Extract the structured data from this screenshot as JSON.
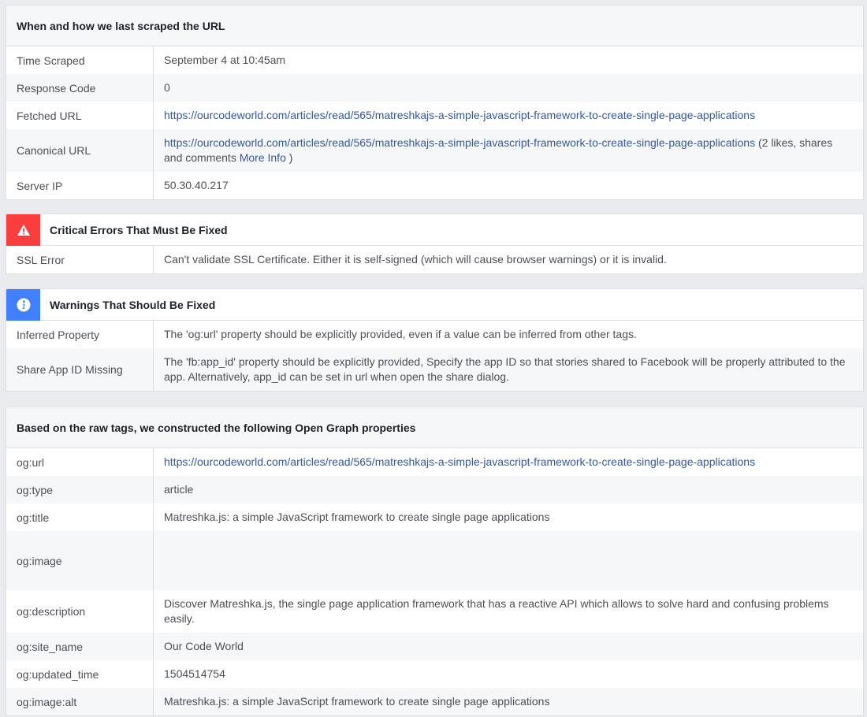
{
  "scrape": {
    "header": "When and how we last scraped the URL",
    "rows": [
      {
        "label": "Time Scraped",
        "value": "September 4 at 10:45am"
      },
      {
        "label": "Response Code",
        "value": "0"
      },
      {
        "label": "Fetched URL",
        "value": "https://ourcodeworld.com/articles/read/565/matreshkajs-a-simple-javascript-framework-to-create-single-page-applications"
      },
      {
        "label": "Canonical URL",
        "link": "https://ourcodeworld.com/articles/read/565/matreshkajs-a-simple-javascript-framework-to-create-single-page-applications",
        "suffix": " (2 likes, shares and comments ",
        "more_info": "More Info",
        "close": " )"
      },
      {
        "label": "Server IP",
        "value": "50.30.40.217"
      }
    ]
  },
  "critical": {
    "header": "Critical Errors That Must Be Fixed",
    "icon": "warning-triangle-icon",
    "color": "#fa3e3e",
    "rows": [
      {
        "label": "SSL Error",
        "value": "Can't validate SSL Certificate. Either it is self-signed (which will cause browser warnings) or it is invalid."
      }
    ]
  },
  "warnings": {
    "header": "Warnings That Should Be Fixed",
    "icon": "info-icon",
    "color": "#4080ff",
    "rows": [
      {
        "label": "Inferred Property",
        "value": "The 'og:url' property should be explicitly provided, even if a value can be inferred from other tags."
      },
      {
        "label": "Share App ID Missing",
        "value": "The 'fb:app_id' property should be explicitly provided, Specify the app ID so that stories shared to Facebook will be properly attributed to the app. Alternatively, app_id can be set in url when open the share dialog."
      }
    ]
  },
  "og": {
    "header": "Based on the raw tags, we constructed the following Open Graph properties",
    "rows": [
      {
        "label": "og:url",
        "value": "https://ourcodeworld.com/articles/read/565/matreshkajs-a-simple-javascript-framework-to-create-single-page-applications"
      },
      {
        "label": "og:type",
        "value": "article"
      },
      {
        "label": "og:title",
        "value": "Matreshka.js: a simple JavaScript framework to create single page applications"
      },
      {
        "label": "og:image",
        "value": ""
      },
      {
        "label": "og:description",
        "value": "Discover Matreshka.js, the single page application framework that has a reactive API which allows to solve hard and confusing problems easily."
      },
      {
        "label": "og:site_name",
        "value": "Our Code World"
      },
      {
        "label": "og:updated_time",
        "value": "1504514754"
      },
      {
        "label": "og:image:alt",
        "value": "Matreshka.js: a simple JavaScript framework to create single page applications"
      }
    ]
  }
}
